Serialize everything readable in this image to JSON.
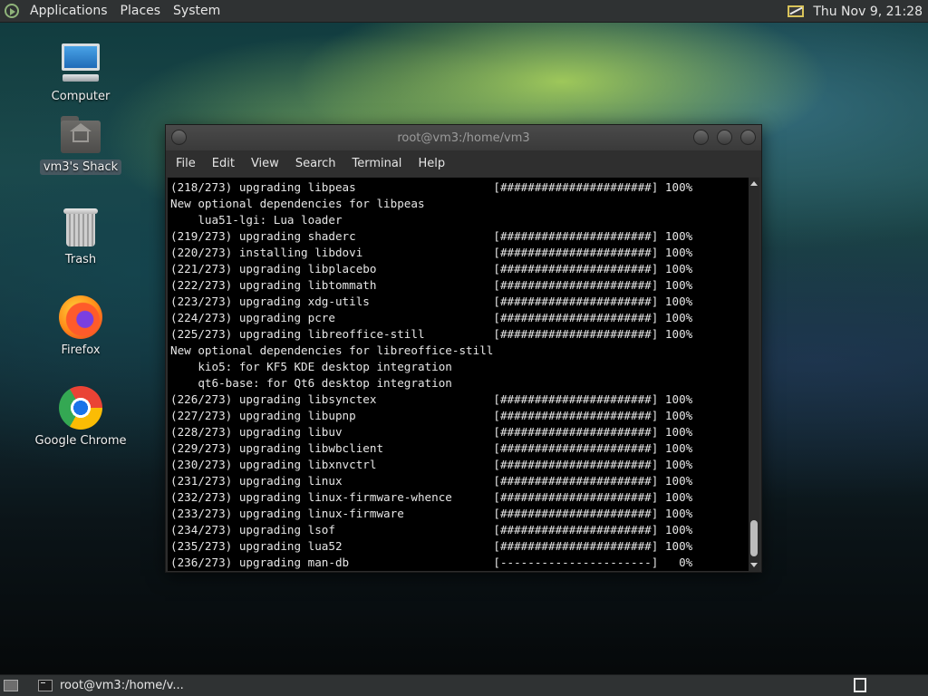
{
  "top_panel": {
    "menus": [
      "Applications",
      "Places",
      "System"
    ],
    "clock": "Thu Nov  9, 21:28"
  },
  "desktop_icons": [
    {
      "label": "Computer",
      "icon": "computer-icon"
    },
    {
      "label": "vm3's Shack",
      "icon": "home-folder-icon",
      "selected": true
    },
    {
      "label": "Trash",
      "icon": "trash-icon"
    },
    {
      "label": "Firefox",
      "icon": "firefox-icon"
    },
    {
      "label": "Google Chrome",
      "icon": "chrome-icon"
    }
  ],
  "terminal": {
    "title": "root@vm3:/home/vm3",
    "menu": [
      "File",
      "Edit",
      "View",
      "Search",
      "Terminal",
      "Help"
    ],
    "lines": [
      "(218/273) upgrading libpeas                    [######################] 100%",
      "New optional dependencies for libpeas",
      "    lua51-lgi: Lua loader",
      "(219/273) upgrading shaderc                    [######################] 100%",
      "(220/273) installing libdovi                   [######################] 100%",
      "(221/273) upgrading libplacebo                 [######################] 100%",
      "(222/273) upgrading libtommath                 [######################] 100%",
      "(223/273) upgrading xdg-utils                  [######################] 100%",
      "(224/273) upgrading pcre                       [######################] 100%",
      "(225/273) upgrading libreoffice-still          [######################] 100%",
      "New optional dependencies for libreoffice-still",
      "    kio5: for KF5 KDE desktop integration",
      "    qt6-base: for Qt6 desktop integration",
      "(226/273) upgrading libsynctex                 [######################] 100%",
      "(227/273) upgrading libupnp                    [######################] 100%",
      "(228/273) upgrading libuv                      [######################] 100%",
      "(229/273) upgrading libwbclient                [######################] 100%",
      "(230/273) upgrading libxnvctrl                 [######################] 100%",
      "(231/273) upgrading linux                      [######################] 100%",
      "(232/273) upgrading linux-firmware-whence      [######################] 100%",
      "(233/273) upgrading linux-firmware             [######################] 100%",
      "(234/273) upgrading lsof                       [######################] 100%",
      "(235/273) upgrading lua52                      [######################] 100%",
      "(236/273) upgrading man-db                     [----------------------]   0%"
    ]
  },
  "taskbar": {
    "task_label": "root@vm3:/home/v..."
  }
}
